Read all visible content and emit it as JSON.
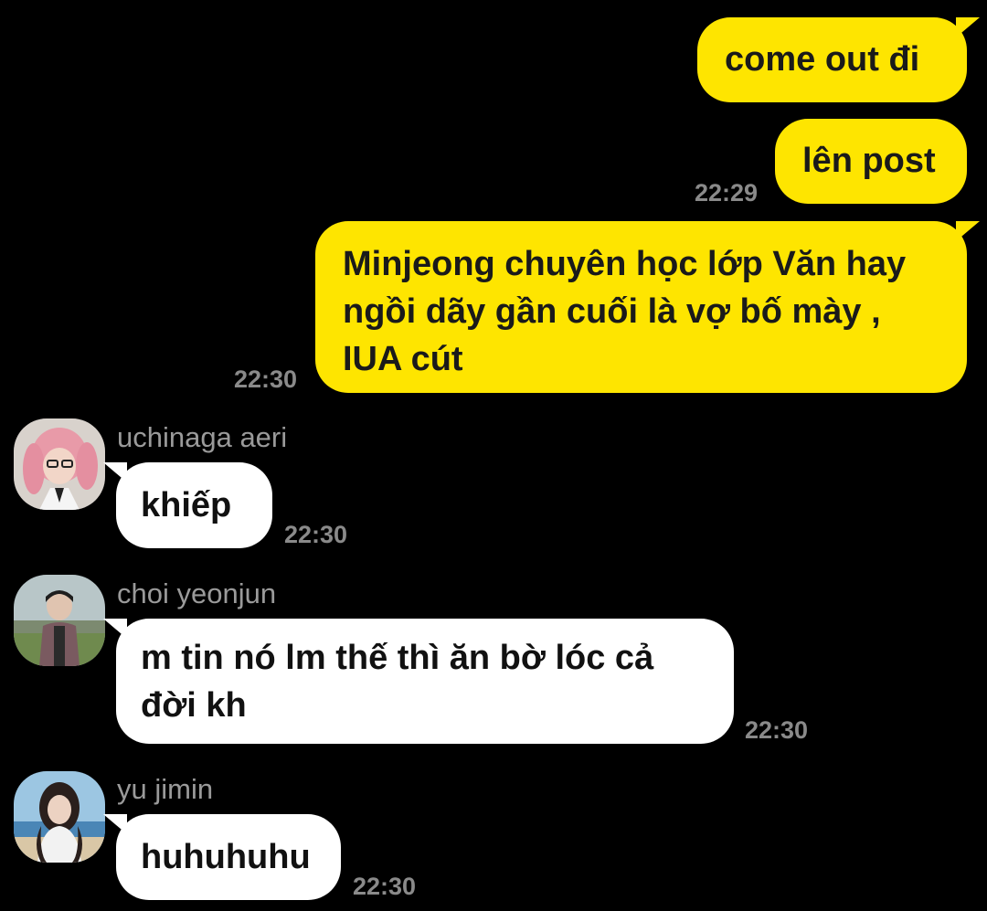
{
  "messages": {
    "m1": {
      "text": "come out đi"
    },
    "m2": {
      "text": "lên post",
      "time": "22:29"
    },
    "m3": {
      "line1": "Minjeong chuyên học lớp Văn hay",
      "line2": "ngồi dãy gần cuối là vợ bố mày ,",
      "line3": "IUA cút",
      "time": "22:30"
    },
    "m4": {
      "sender": "uchinaga aeri",
      "text": "khiếp",
      "time": "22:30"
    },
    "m5": {
      "sender": "choi yeonjun",
      "line1": "m tin nó lm thế thì ăn bờ lóc cả",
      "line2": "đời kh",
      "time": "22:30"
    },
    "m6": {
      "sender": "yu jimin",
      "text": "huhuhuhu",
      "time": "22:30"
    }
  },
  "colors": {
    "background": "#000000",
    "my_bubble": "#fee500",
    "their_bubble": "#ffffff",
    "timestamp": "#8a8a8a",
    "sender_name": "#9a9a9a"
  }
}
